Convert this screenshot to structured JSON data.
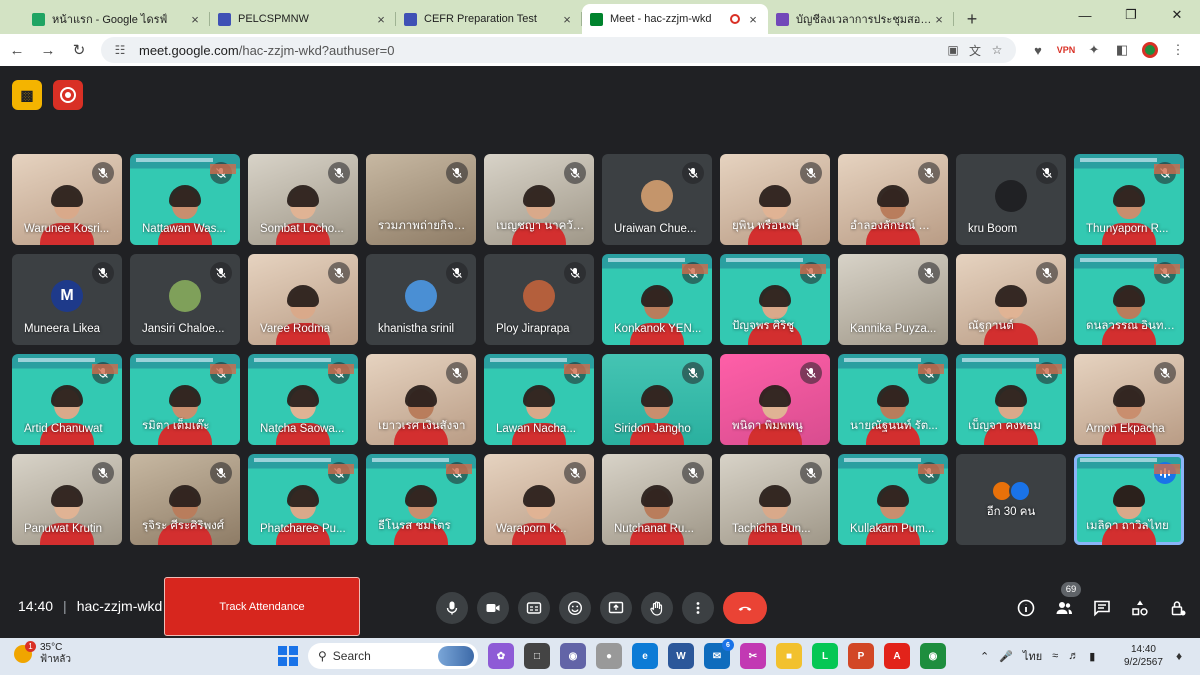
{
  "browser": {
    "tabs": [
      {
        "title": "หน้าแรก - Google ไดรฟ์",
        "favicon": "google-drive-icon",
        "color": "#1fa463",
        "active": false
      },
      {
        "title": "PELCSPMNW",
        "favicon": "google-sites-icon",
        "color": "#3f51b5",
        "active": false
      },
      {
        "title": "CEFR Preparation Test",
        "favicon": "google-sites-icon",
        "color": "#3f51b5",
        "active": false
      },
      {
        "title": "Meet - hac-zzjm-wkd",
        "favicon": "google-meet-icon",
        "color": "#00832d",
        "active": true
      },
      {
        "title": "บัญชีลงเวลาการประชุมสอบ CEFR ปี",
        "favicon": "google-forms-icon",
        "color": "#7248b9",
        "active": false
      }
    ],
    "url_host": "meet.google.com",
    "url_path": "/hac-zzjm-wkd?authuser=0"
  },
  "meet": {
    "participants": [
      {
        "name": "Warunee Kosri...",
        "tile": "warm",
        "avatar": null,
        "person": true
      },
      {
        "name": "Nattawan Was...",
        "tile": "slide",
        "avatar": null,
        "person": true
      },
      {
        "name": "Sombat Locho...",
        "tile": "room",
        "avatar": null,
        "person": true
      },
      {
        "name": "รวมภาพถ่ายกิจก...",
        "tile": "photo",
        "avatar": null,
        "person": false
      },
      {
        "name": "เบญชญา นาควัฒน์",
        "tile": "room",
        "avatar": null,
        "person": true
      },
      {
        "name": "Uraiwan Chue...",
        "tile": "plain",
        "avatar": "#c4956b",
        "avatar_letter": "",
        "person": false
      },
      {
        "name": "ยุพิน พรือนงษ์",
        "tile": "warm",
        "avatar": null,
        "person": true
      },
      {
        "name": "อำลองลักษณ์ คำ...",
        "tile": "warm",
        "avatar": null,
        "person": true
      },
      {
        "name": "kru Boom",
        "tile": "plain",
        "avatar": "#202124",
        "avatar_letter": "",
        "person": false
      },
      {
        "name": "Thunyaporn R...",
        "tile": "slide",
        "avatar": null,
        "person": true
      },
      {
        "name": "Muneera Likea",
        "tile": "plain",
        "avatar": "#1e3a8a",
        "avatar_letter": "M",
        "person": false
      },
      {
        "name": "Jansiri Chaloe...",
        "tile": "plain",
        "avatar": "#7fa05a",
        "avatar_letter": "",
        "person": false
      },
      {
        "name": "Varee Rodma",
        "tile": "warm",
        "avatar": null,
        "person": true
      },
      {
        "name": "khanistha srinil",
        "tile": "plain",
        "avatar": "#4a8fd4",
        "avatar_letter": "",
        "person": false
      },
      {
        "name": "Ploy Jiraprapa",
        "tile": "plain",
        "avatar": "#b45f3c",
        "avatar_letter": "",
        "person": false
      },
      {
        "name": "Konkanok YEN...",
        "tile": "slide",
        "avatar": null,
        "person": true
      },
      {
        "name": "ปัญจพร ศิริชู",
        "tile": "slide",
        "avatar": null,
        "person": true
      },
      {
        "name": "Kannika Puyza...",
        "tile": "room",
        "avatar": null,
        "person": false
      },
      {
        "name": "ณัฐกานต์",
        "tile": "warm",
        "avatar": null,
        "person": true
      },
      {
        "name": "ดนลวรรณ อินทร...",
        "tile": "slide",
        "avatar": null,
        "person": true
      },
      {
        "name": "Artid Chanuwat",
        "tile": "slide",
        "avatar": null,
        "person": true
      },
      {
        "name": "รมิตา เต็มเต๊ะ",
        "tile": "slide",
        "avatar": null,
        "person": true
      },
      {
        "name": "Natcha Saowa...",
        "tile": "slide",
        "avatar": null,
        "person": true
      },
      {
        "name": "เยาวเรศ เงินสังจา",
        "tile": "warm",
        "avatar": null,
        "person": true
      },
      {
        "name": "Lawan Nacha...",
        "tile": "slide",
        "avatar": null,
        "person": true
      },
      {
        "name": "Siridon Jangho",
        "tile": "teal2",
        "avatar": null,
        "person": true
      },
      {
        "name": "พนิดา พิมพหนู",
        "tile": "pink",
        "avatar": null,
        "person": true
      },
      {
        "name": "นายณัฐนนท์ รัต...",
        "tile": "slide",
        "avatar": null,
        "person": true
      },
      {
        "name": "เบ็ญจา คงหอม",
        "tile": "slide",
        "avatar": null,
        "person": true
      },
      {
        "name": "Arnon Ekpacha",
        "tile": "warm",
        "avatar": null,
        "person": true
      },
      {
        "name": "Panuwat Krutin",
        "tile": "room",
        "avatar": null,
        "person": true
      },
      {
        "name": "รุจิระ ศีระศิริพงศ์",
        "tile": "photo",
        "avatar": null,
        "person": true
      },
      {
        "name": "Phatcharee Pu...",
        "tile": "slide",
        "avatar": null,
        "person": true
      },
      {
        "name": "ธีโนรส ชมโตร",
        "tile": "slide",
        "avatar": null,
        "person": true
      },
      {
        "name": "Waraporn K...",
        "tile": "warm",
        "avatar": null,
        "person": true
      },
      {
        "name": "Nutchanat Ru...",
        "tile": "room",
        "avatar": null,
        "person": true
      },
      {
        "name": "Tachicha Bun...",
        "tile": "room",
        "avatar": null,
        "person": true
      },
      {
        "name": "Kullakarn Pum...",
        "tile": "slide",
        "avatar": null,
        "person": true
      }
    ],
    "more_label": "อีก 30 คน",
    "self_name": "เมลิดา ถาวิลไทย",
    "meeting_time": "14:40",
    "meeting_code": "hac-zzjm-wkd",
    "attendance_label": "Track Attendance",
    "people_count": "69"
  },
  "taskbar": {
    "temperature": "35°C",
    "weather_desc": "ฟ้าหลัว",
    "weather_badge": "1",
    "search_label": "Search",
    "lang": "ไทย",
    "clock_time": "14:40",
    "clock_date": "9/2/2567",
    "app_badge": "6"
  }
}
